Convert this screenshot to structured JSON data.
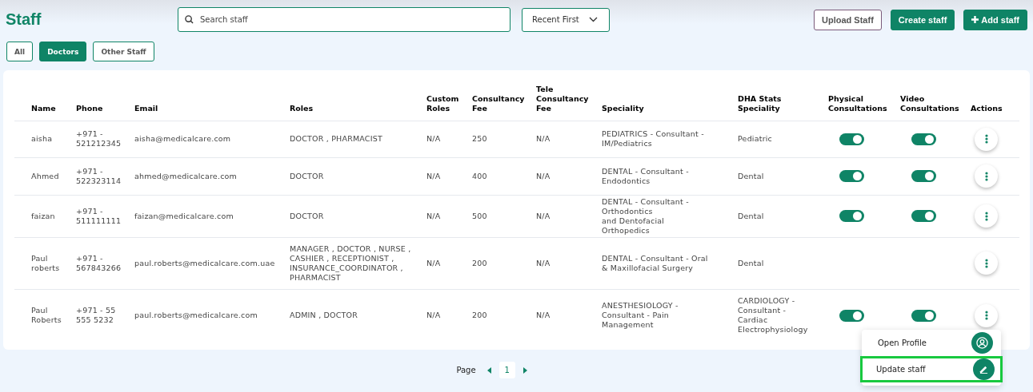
{
  "title": "Staff",
  "search": {
    "placeholder": "Search staff"
  },
  "sort": {
    "value": "Recent First"
  },
  "header_buttons": [
    {
      "label": "Upload Staff",
      "kind": "outline"
    },
    {
      "label": "Create staff",
      "kind": "solid"
    },
    {
      "label": "Add staff",
      "kind": "add"
    }
  ],
  "filters": [
    {
      "label": "All",
      "selected": false
    },
    {
      "label": "Doctors",
      "selected": true
    },
    {
      "label": "Other Staff",
      "selected": false
    }
  ],
  "table": {
    "columns": [
      "Name",
      "Phone",
      "Email",
      "Roles",
      "Custom Roles",
      "Consultancy Fee",
      "Tele Consultancy Fee",
      "Speciality",
      "DHA Stats Speciality",
      "Physical Consultations",
      "Video Consultations",
      "Actions"
    ],
    "rows": [
      {
        "name": "aisha",
        "phone": "+971 - 521212345",
        "email": "aisha@medicalcare.com",
        "roles": "DOCTOR , PHARMACIST",
        "custom_roles": "N/A",
        "fee": "250",
        "tele_fee": "N/A",
        "speciality": [
          "PEDIATRICS - Consultant - IM/Pediatrics"
        ],
        "dha": "Pediatric",
        "physical": {
          "on": true
        },
        "video": {
          "on": true
        }
      },
      {
        "name": "Ahmed",
        "phone": "+971 - 522323114",
        "email": "ahmed@medicalcare.com",
        "roles": "DOCTOR",
        "custom_roles": "N/A",
        "fee": "400",
        "tele_fee": "N/A",
        "speciality": [
          "DENTAL - Consultant - Endodontics"
        ],
        "dha": "Dental",
        "physical": {
          "on": true
        },
        "video": {
          "on": true
        }
      },
      {
        "name": "faizan",
        "phone": "+971 - 511111111",
        "email": "faizan@medicalcare.com",
        "roles": "DOCTOR",
        "custom_roles": "N/A",
        "fee": "500",
        "tele_fee": "N/A",
        "speciality": [
          "DENTAL - Consultant - Orthodontics",
          "and Dentofacial Orthopedics"
        ],
        "dha": "Dental",
        "physical": {
          "on": true
        },
        "video": {
          "on": true
        }
      },
      {
        "name": "Paul roberts",
        "phone": "+971 - 567843266",
        "email": "paul.roberts@medicalcare.com.uae",
        "roles": "MANAGER , DOCTOR , NURSE , CASHIER , RECEPTIONIST , INSURANCE_COORDINATOR , PHARMACIST",
        "custom_roles": "N/A",
        "fee": "200",
        "tele_fee": "N/A",
        "speciality": [
          "DENTAL - Consultant - Oral & Maxillofacial Surgery"
        ],
        "dha": "Dental"
      },
      {
        "name": "Paul Roberts",
        "phone": "+971 - 55 555 5232",
        "email": "paul.roberts@medicalcare.com",
        "roles": "ADMIN , DOCTOR",
        "custom_roles": "N/A",
        "fee": "200",
        "tele_fee": "N/A",
        "speciality": [
          "ANESTHESIOLOGY - Consultant - Pain Management"
        ],
        "dha": "CARDIOLOGY - Consultant - Cardiac Electrophysiology",
        "physical": {
          "on": true
        },
        "video": {
          "on": true
        }
      }
    ]
  },
  "action_menu": [
    {
      "label": "Open Profile",
      "kind": "profile",
      "highlighted": false
    },
    {
      "label": "Update staff",
      "kind": "edit",
      "highlighted": true
    }
  ],
  "pagination": {
    "label": "Page",
    "pages": [
      {
        "label": "1",
        "selected": true
      }
    ]
  }
}
